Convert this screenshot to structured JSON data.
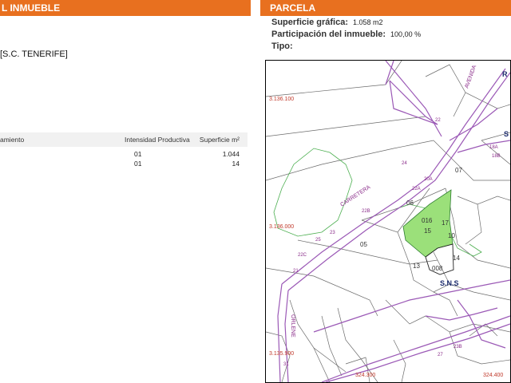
{
  "left_panel": {
    "header": "L INMUEBLE",
    "location": "[S.C. TENERIFE]",
    "table": {
      "headers": [
        "amiento",
        "Intensidad Productiva",
        "Superficie m²"
      ],
      "rows": [
        {
          "intensity": "01",
          "area": "1.044"
        },
        {
          "intensity": "01",
          "area": "14"
        }
      ]
    }
  },
  "right_panel": {
    "header": "PARCELA",
    "fields": [
      {
        "label": "Superficie gráfica:",
        "value": "1.058 m2"
      },
      {
        "label": "Participación del inmueble:",
        "value": "100,00 %"
      },
      {
        "label": "Tipo:",
        "value": ""
      }
    ]
  },
  "map": {
    "coordinates": {
      "y_top": "3.136.100",
      "y_mid": "3.136.000",
      "y_bottom": "3.135.900",
      "x_left": "324.300",
      "x_right": "324.400"
    },
    "parcels": [
      "07",
      "06",
      "016",
      "15",
      "10",
      "17",
      "05",
      "13",
      "008",
      "14"
    ],
    "road_labels": [
      "CARRETERA",
      "AVENIDA",
      "ORLENE"
    ],
    "road_numbers": [
      "22",
      "22A",
      "22B",
      "22C",
      "23",
      "24",
      "20A",
      "25",
      "21",
      "31",
      "27",
      "23B",
      "18A",
      "18B"
    ],
    "area_labels": [
      "S.N.S",
      "R",
      "S"
    ]
  },
  "colors": {
    "header_bg": "#e8701f",
    "parcel_fill": "#9be07a",
    "road_line": "#9b59b6",
    "coord_text": "#c0392b"
  }
}
